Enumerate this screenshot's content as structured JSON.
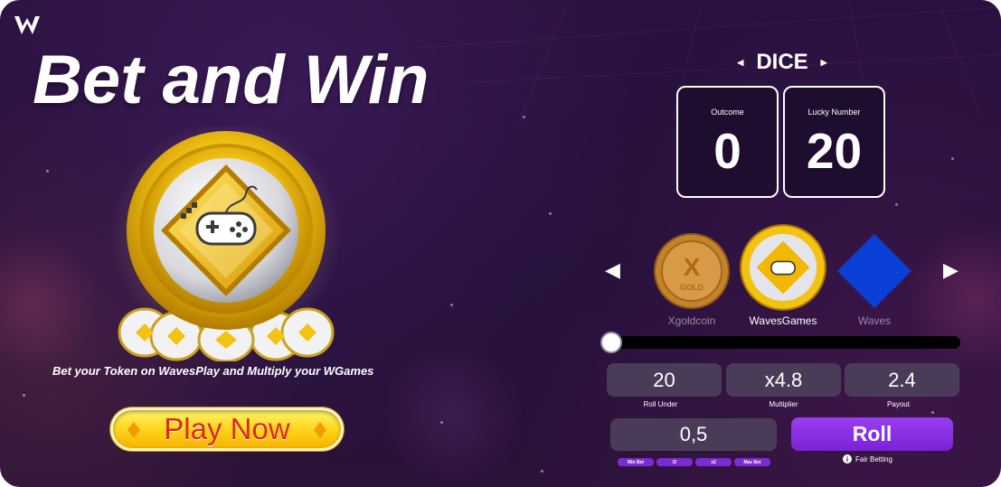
{
  "hero": {
    "title": "Bet and Win",
    "tagline": "Bet your Token on WavesPlay and Multiply your WGames",
    "play_button_label": "Play Now"
  },
  "game": {
    "title": "DICE",
    "outcome": {
      "label": "Outcome",
      "value": "0"
    },
    "lucky_number": {
      "label": "Lucky Number",
      "value": "20"
    },
    "tokens": [
      {
        "name": "Xgoldcoin",
        "icon": "xgoldcoin-token-icon",
        "selected": false
      },
      {
        "name": "WavesGames",
        "icon": "wavesgames-token-icon",
        "selected": true
      },
      {
        "name": "Waves",
        "icon": "waves-token-icon",
        "selected": false
      }
    ],
    "slider_value": 0,
    "roll_under": {
      "value": "20",
      "label": "Roll Under"
    },
    "multiplier": {
      "value": "x4.8",
      "label": "Multiplier"
    },
    "payout": {
      "value": "2.4",
      "label": "Payout"
    },
    "bet_amount": "0,5",
    "quick_bets": [
      "Min Bet",
      "/2",
      "x2",
      "Max Bet"
    ],
    "roll_label": "Roll",
    "fair_betting_label": "Fair Betting",
    "info_glyph": "i"
  },
  "colors": {
    "background": "#24103a",
    "accent_purple": "#7a22d8",
    "gold": "#ffd51c",
    "play_text": "#e0281a",
    "field_bg": "#4a3c58"
  }
}
